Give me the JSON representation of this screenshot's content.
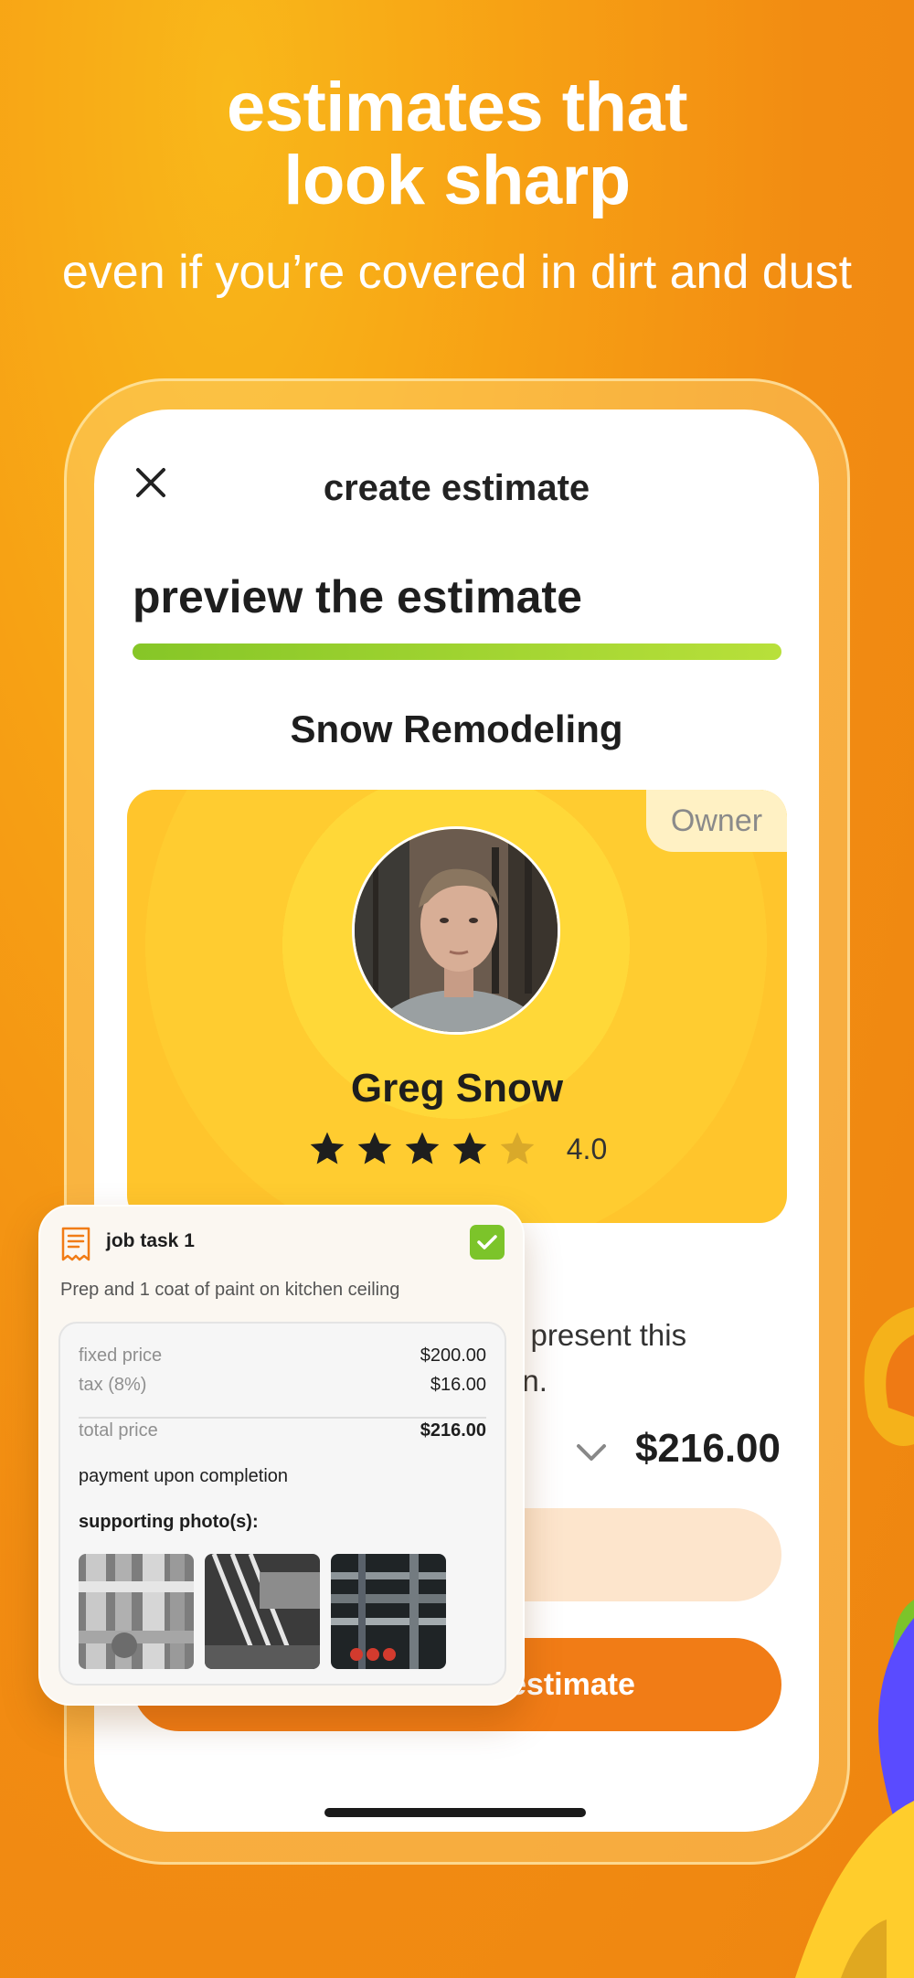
{
  "hero": {
    "title_line1": "estimates that",
    "title_line2": "look sharp",
    "subtitle": "even if you’re covered in dirt and dust"
  },
  "header": {
    "title": "create estimate",
    "close_icon": "close-icon"
  },
  "step": {
    "title": "preview the estimate",
    "progress": 1.0
  },
  "company": {
    "name": "Snow Remodeling"
  },
  "profile": {
    "badge": "Owner",
    "name": "Greg Snow",
    "rating": 4.0,
    "rating_text": "4.0",
    "stars_total": 5
  },
  "background_text": {
    "line1": "o present this",
    "line2": "on."
  },
  "summary": {
    "total": "$216.00",
    "expand_icon": "chevron-down-icon",
    "primary_button_label": "estimate"
  },
  "task": {
    "icon": "receipt-icon",
    "title": "job task 1",
    "completed_icon": "check-icon",
    "description": "Prep and 1 coat of paint on kitchen ceiling",
    "fixed_price_label": "fixed price",
    "fixed_price": "$200.00",
    "tax_label": "tax (8%)",
    "tax": "$16.00",
    "total_label": "total price",
    "total": "$216.00",
    "payment_terms": "payment upon completion",
    "photos_heading": "supporting photo(s):"
  },
  "colors": {
    "accent_orange": "#f17c16",
    "progress_green": "#86c627",
    "card_yellow": "#ffc52c",
    "check_green": "#7cc42a"
  }
}
